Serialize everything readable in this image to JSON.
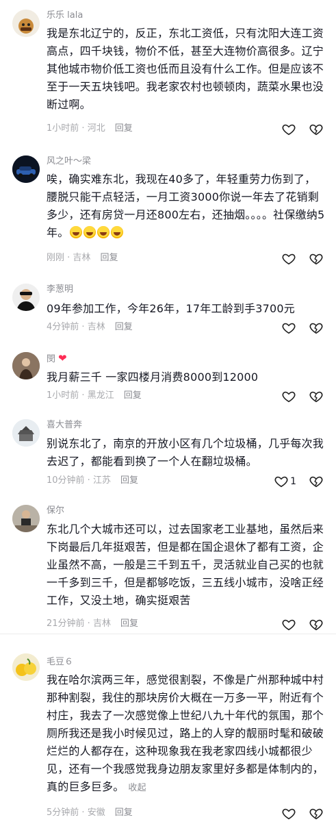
{
  "comments": [
    {
      "username": "乐乐 lala",
      "text": "我是东北辽宁的，反正，东北工资低，只有沈阳大连工资高点，四千块钱，物价不低，甚至大连物价高很多。辽宁其他城市物价低工资也低而且没有什么工作。但是应该不至于一天五块钱吧。我老家农村也顿顿肉，蔬菜水果也没断过啊。",
      "time": "1小时前",
      "location": "河北",
      "reply": "回复",
      "likes": ""
    },
    {
      "username": "风之叶～梁",
      "text": "唉，确实难东北，我现在40多了，年轻重劳力伤到了，腰脱只能干点轻活，一月工资3000你说一年去了花销剩多少，还有房贷一月还800左右，还抽烟。。。。社保缴纳5年。",
      "time": "刚刚",
      "location": "吉林",
      "reply": "回复",
      "likes": ""
    },
    {
      "username": "李葱明",
      "text": "09年参加工作，今年26年，17年工龄到手3700元",
      "time": "4分钟前",
      "location": "吉林",
      "reply": "回复",
      "likes": ""
    },
    {
      "username": "閔",
      "text": "我月薪三千 一家四楼月消费8000到12000",
      "time": "1小时前",
      "location": "黑龙江",
      "reply": "回复",
      "likes": ""
    },
    {
      "username": "喜大普奔",
      "text": "别说东北了，南京的开放小区有几个垃圾桶，几乎每次我去迟了，都能看到换了一个人在翻垃圾桶。",
      "time": "10分钟前",
      "location": "江苏",
      "reply": "回复",
      "likes": "1"
    },
    {
      "username": "保尔",
      "text": "东北几个大城市还可以，过去国家老工业基地，虽然后来下岗最后几年挺艰苦，但是都在国企退休了都有工资，企业虽然不高，一般是三千到五千，灵活就业自己买的也就一千多到三千，但是都够吃饭，三五线小城市，没啥正经工作，又没土地，确实挺艰苦",
      "time": "21分钟前",
      "location": "吉林",
      "reply": "回复",
      "likes": ""
    },
    {
      "username": "毛豆６",
      "text": "我在哈尔滨两三年，感觉很割裂，不像是广州那种城中村那种割裂，我住的那块房价大概在一万多一平，附近有个村庄，我去了一次感觉像上世纪八九十年代的氛围，那个厕所我还是我小时候见过，路上的人穿的靓丽时髦和破破烂烂的人都存在，这种现象我在我老家四线小城都很少见，还有一个我感觉我身边朋友家里好多都是体制内的，真的巨多巨多。",
      "expand": "收起",
      "time": "5分钟前",
      "location": "安徽",
      "reply": "回复",
      "likes": ""
    }
  ],
  "separator": " · ",
  "colors": {
    "badge_heart": "#fe2c55",
    "meta": "#a8a9ad",
    "text": "#161823"
  }
}
